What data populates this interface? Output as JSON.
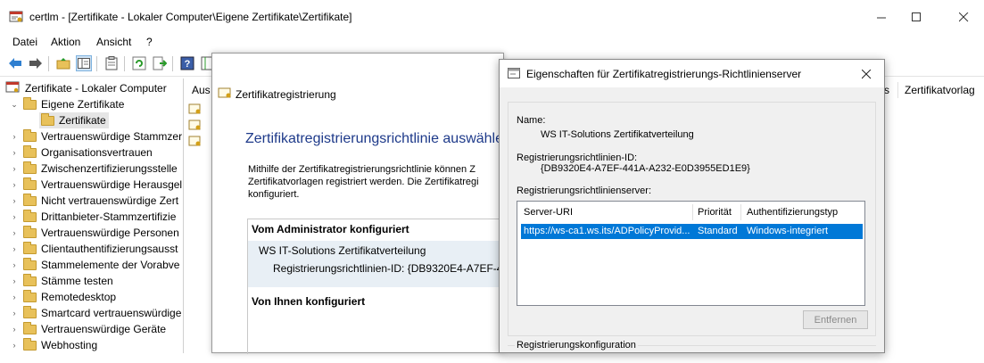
{
  "window": {
    "title": "certlm - [Zertifikate - Lokaler Computer\\Eigene Zertifikate\\Zertifikate]",
    "minimize_icon": "minimize-icon",
    "maximize_icon": "maximize-icon",
    "close_icon": "close-icon"
  },
  "menu": [
    "Datei",
    "Aktion",
    "Ansicht",
    "?"
  ],
  "toolbar": {
    "icons": [
      "back-arrow-icon",
      "forward-arrow-icon",
      "up-folder-icon",
      "show-hide-tree-icon",
      "properties-icon",
      "refresh-icon",
      "export-list-icon",
      "help-icon"
    ]
  },
  "tree": {
    "root": "Zertifikate - Lokaler Computer",
    "eigene": "Eigene Zertifikate",
    "selected": "Zertifikate",
    "items": [
      "Vertrauenswürdige Stammzer",
      "Organisationsvertrauen",
      "Zwischenzertifizierungsstelle",
      "Vertrauenswürdige Herausgel",
      "Nicht vertrauenswürdige Zert",
      "Drittanbieter-Stammzertifizie",
      "Vertrauenswürdige Personen",
      "Clientauthentifizierungsausst",
      "Stammelemente der Vorabve",
      "Stämme testen",
      "Remotedesktop",
      "Smartcard vertrauenswürdige",
      "Vertrauenswürdige Geräte",
      "Webhosting"
    ]
  },
  "list": {
    "col_first": "Aus",
    "col_s": "s",
    "col_template": "Zertifikatvorlag"
  },
  "wizard": {
    "title": "Zertifikatregistrierung",
    "heading": "Zertifikatregistrierungsrichtlinie auswähle",
    "description": "Mithilfe der Zertifikatregistrierungsrichtlinie können Z Zertifikatvorlagen registriert werden. Die Zertifikatregi konfiguriert.",
    "admin_header": "Vom Administrator konfiguriert",
    "policy_name": "WS IT-Solutions Zertifikatverteilung",
    "policy_id": "Registrierungsrichtlinien-ID:  {DB9320E4-A7EF-44",
    "user_header": "Von Ihnen konfiguriert"
  },
  "props": {
    "title": "Eigenschaften für Zertifikatregistrierungs-Richtlinienserver",
    "name_label": "Name:",
    "name_value": "WS IT-Solutions Zertifikatverteilung",
    "id_label": "Registrierungsrichtlinien-ID:",
    "id_value": "{DB9320E4-A7EF-441A-A232-E0D3955ED1E9}",
    "servers_label": "Registrierungsrichtlinienserver:",
    "columns": [
      "Server-URI",
      "Priorität",
      "Authentifizierungstyp"
    ],
    "row": {
      "uri": "https://ws-ca1.ws.its/ADPolicyProvid...",
      "priority": "Standard",
      "auth": "Windows-integriert"
    },
    "remove_button": "Entfernen",
    "config_group": "Registrierungskonfiguration"
  }
}
